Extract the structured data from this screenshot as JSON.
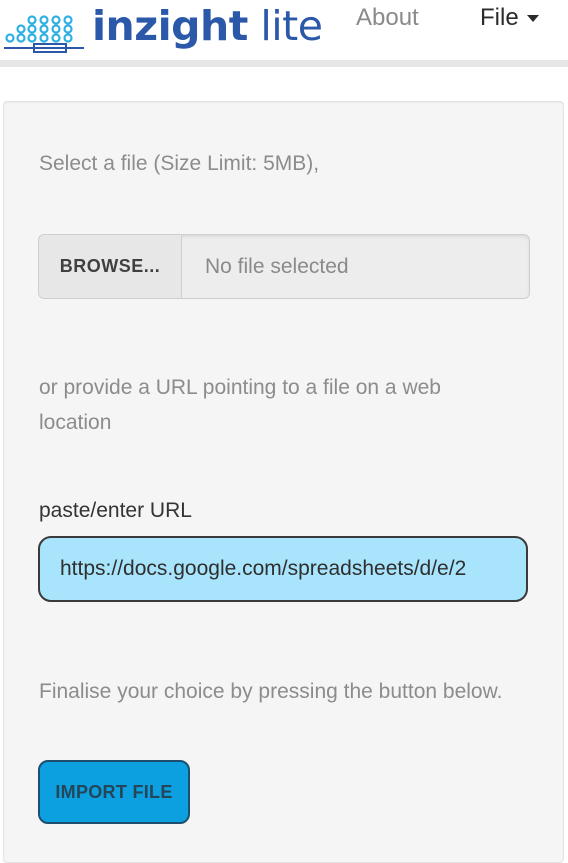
{
  "header": {
    "logo": {
      "brand": "inzight",
      "edition": "lite"
    },
    "nav": {
      "about": "About",
      "file": "File"
    }
  },
  "panel": {
    "select_text": "Select a file (Size Limit: 5MB),",
    "browse_label": "BROWSE...",
    "file_status": "No file selected",
    "url_text": "or provide a URL pointing to a file on a web location",
    "url_label": "paste/enter URL",
    "url_value": "https://docs.google.com/spreadsheets/d/e/2",
    "finalise_text": "Finalise your choice by pressing the button below.",
    "import_label": "IMPORT FILE"
  },
  "colors": {
    "brand_blue": "#2b58a8",
    "brand_cyan": "#2fb0e2",
    "url_field_bg": "#a8e4fb",
    "import_button_bg": "#0ca0e0"
  }
}
